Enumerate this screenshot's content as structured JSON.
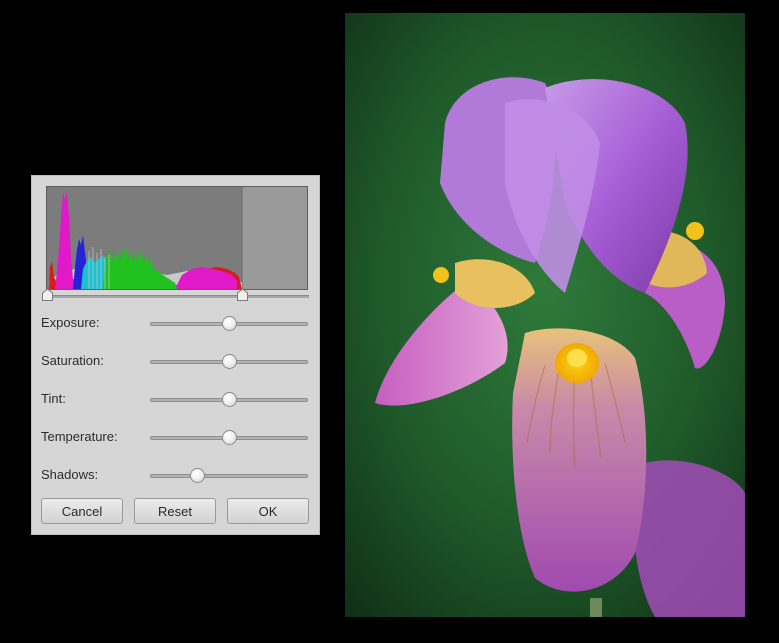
{
  "dialog": {
    "sliders": [
      {
        "id": "exposure",
        "label": "Exposure:",
        "value": 0.5
      },
      {
        "id": "saturation",
        "label": "Saturation:",
        "value": 0.5
      },
      {
        "id": "tint",
        "label": "Tint:",
        "value": 0.5
      },
      {
        "id": "temperature",
        "label": "Temperature:",
        "value": 0.5
      },
      {
        "id": "shadows",
        "label": "Shadows:",
        "value": 0.3
      }
    ],
    "buttons": {
      "cancel": "Cancel",
      "reset": "Reset",
      "ok": "OK"
    },
    "levels": {
      "black_point": 0.0,
      "white_point": 0.75
    }
  },
  "colors": {
    "panel_bg": "#d6d6d6",
    "histogram_bg": "#7c7c7c",
    "histogram_clip": "#9a9a9a",
    "red": "#d81c1c",
    "green": "#1fc21f",
    "blue": "#2424d6",
    "magenta": "#e01ac8",
    "cyan": "#1fc0d0"
  },
  "preview": {
    "subject": "purple iris flower on green background"
  }
}
